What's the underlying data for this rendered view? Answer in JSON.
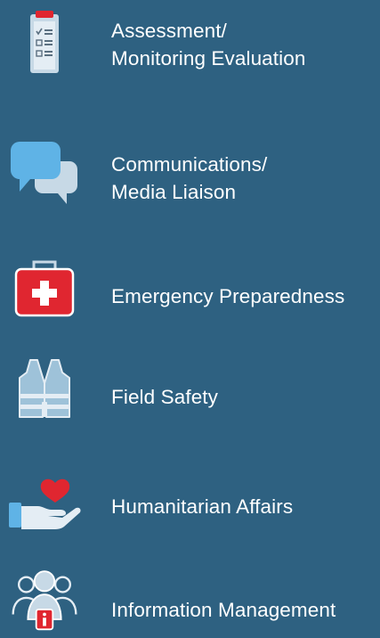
{
  "items": [
    {
      "icon": "clipboard-checklist-icon",
      "lines": [
        "Assessment/",
        "Monitoring Evaluation"
      ]
    },
    {
      "icon": "speech-bubbles-icon",
      "lines": [
        "Communications/",
        "Media Liaison"
      ]
    },
    {
      "icon": "first-aid-kit-icon",
      "lines": [
        "Emergency Preparedness"
      ]
    },
    {
      "icon": "safety-vest-icon",
      "lines": [
        "Field Safety"
      ]
    },
    {
      "icon": "hand-heart-icon",
      "lines": [
        "Humanitarian Affairs"
      ]
    },
    {
      "icon": "people-info-icon",
      "lines": [
        "Information Management"
      ]
    }
  ],
  "colors": {
    "background": "#2e6181",
    "icon_light": "#c7d9e6",
    "icon_blue": "#5fb3e6",
    "accent_red": "#e02630"
  }
}
